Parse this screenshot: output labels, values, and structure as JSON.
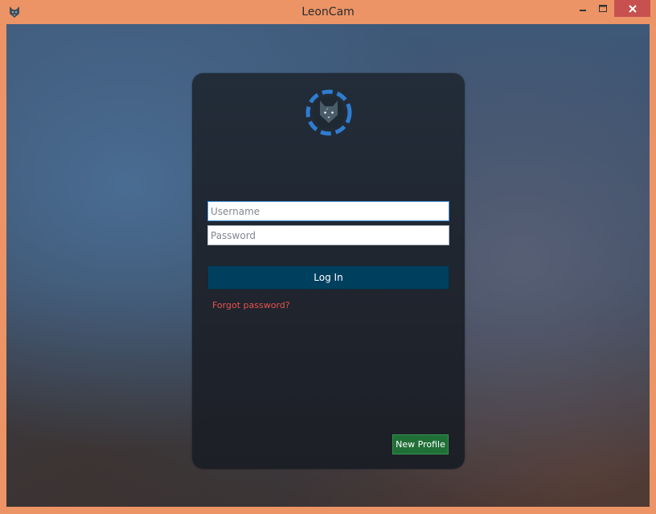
{
  "window": {
    "title": "LeonCam",
    "icon": "leoncam-cat-icon",
    "controls": [
      "minimize-icon",
      "maximize-icon",
      "close-icon"
    ]
  },
  "login": {
    "logo": "leoncam-cat-logo-icon",
    "username_placeholder": "Username",
    "password_placeholder": "Password",
    "login_label": "Log In",
    "forgot_label": "Forgot password?",
    "new_profile_label": "New Profile"
  },
  "colors": {
    "window_border": "#ec9466",
    "close_button": "#c7514f",
    "panel": "#202630",
    "login_button": "#00405f",
    "forgot_link": "#e8524a",
    "new_profile_button": "#1f6f36",
    "logo_ring": "#2f7dd1"
  }
}
